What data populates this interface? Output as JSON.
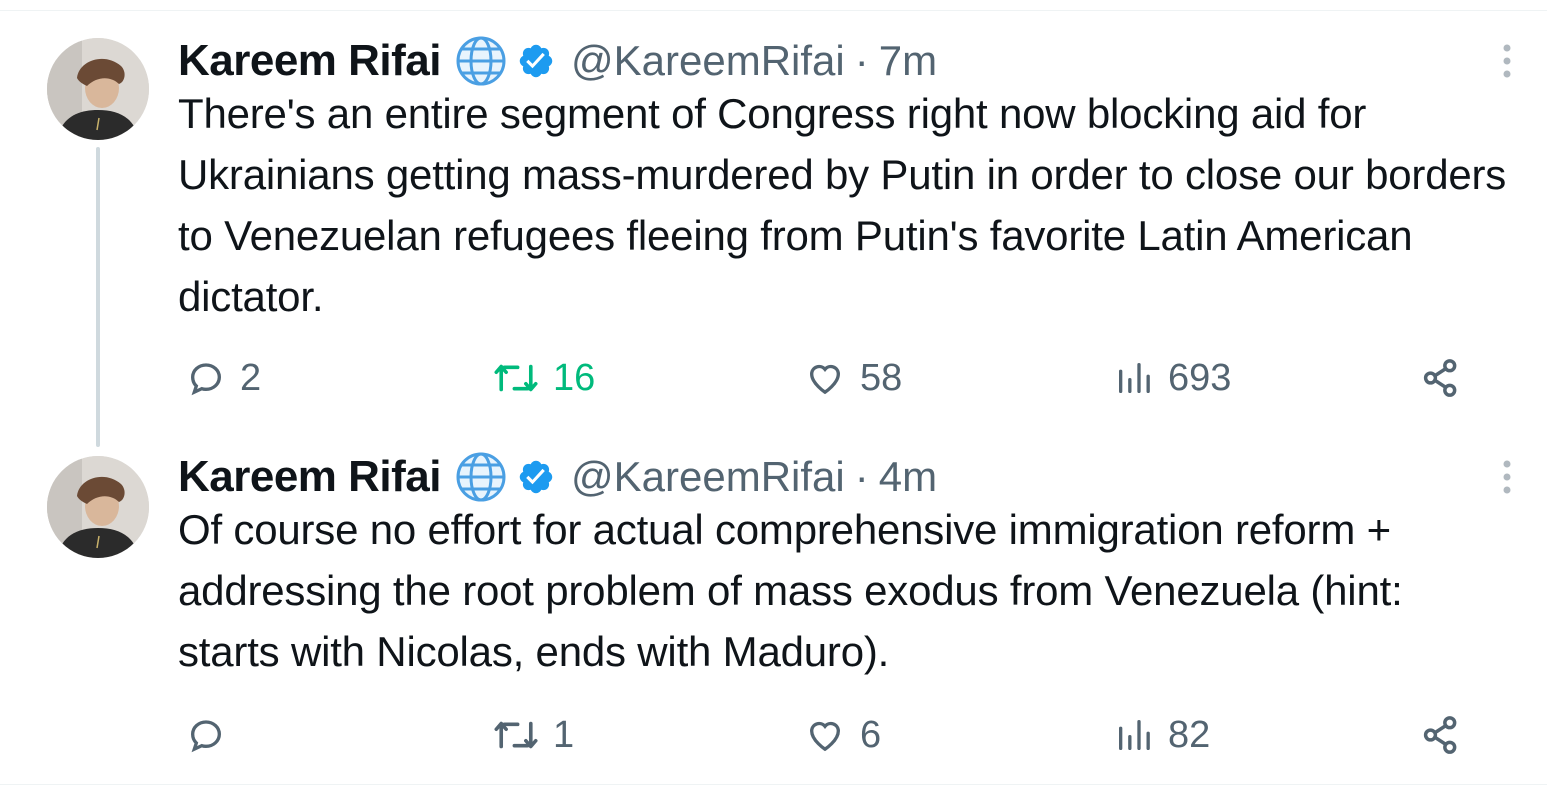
{
  "tweets": [
    {
      "author_name": "Kareem Rifai",
      "handle": "@KareemRifai",
      "separator": "·",
      "time": "7m",
      "text": "There's an entire segment of Congress right now blocking aid for Ukrainians getting mass-murdered by Putin in order to close our borders to Venezuelan refugees fleeing from Putin's favorite Latin American dictator.",
      "replies": "2",
      "retweets": "16",
      "likes": "58",
      "views": "693",
      "retweeted": true
    },
    {
      "author_name": "Kareem Rifai",
      "handle": "@KareemRifai",
      "separator": "·",
      "time": "4m",
      "text": "Of course no effort for actual comprehensive immigration reform + addressing the root problem of mass exodus from Venezuela (hint: starts with Nicolas, ends with Maduro).",
      "replies": "",
      "retweets": "1",
      "likes": "6",
      "views": "82",
      "retweeted": false
    }
  ],
  "icons": {
    "globe": "globe-icon",
    "verified": "verified-badge-icon",
    "more": "more-options-icon",
    "reply": "reply-icon",
    "retweet": "retweet-icon",
    "like": "heart-icon",
    "views": "views-bar-icon",
    "share": "share-icon"
  },
  "colors": {
    "text": "#0f1419",
    "secondary": "#536471",
    "verified": "#1d9bf0",
    "retweet_active": "#00ba7c",
    "thread_line": "#cfd9de"
  }
}
